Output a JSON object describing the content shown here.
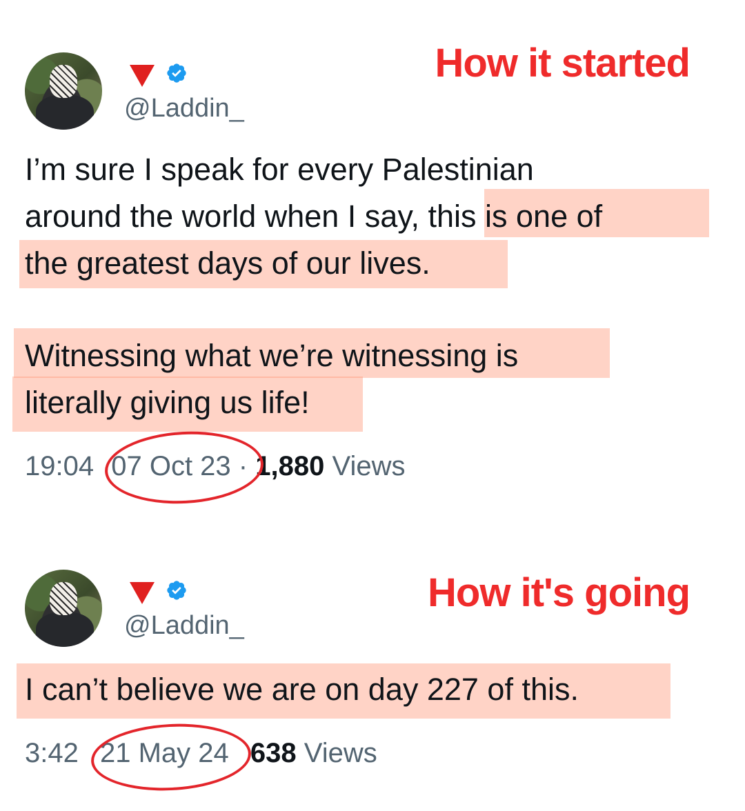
{
  "tweet1": {
    "handle": "@Laddin_",
    "caption": "How it started",
    "text_lines": [
      "I’m sure I speak for every Palestinian",
      "around the world when I say, this is one of",
      "the greatest days of our lives.",
      "Witnessing what we’re witnessing is",
      "literally giving us life!"
    ],
    "time": "19:04",
    "date": "07 Oct 23",
    "separator": "·",
    "views_count": "1,880",
    "views_label": "Views"
  },
  "tweet2": {
    "handle": "@Laddin_",
    "caption": "How it's going",
    "text_lines": [
      "I can’t believe we are on day 227 of this."
    ],
    "time": "3:42",
    "date": "21 May 24",
    "views_count": "638",
    "views_label": "Views"
  },
  "colors": {
    "caption": "#ef2b2b",
    "highlight": "#ffb4a0",
    "circle": "#e3252b",
    "verified": "#1d9bf0",
    "flag": "#e0201f"
  },
  "icons": [
    "red-triangle-icon",
    "verified-badge-icon"
  ]
}
